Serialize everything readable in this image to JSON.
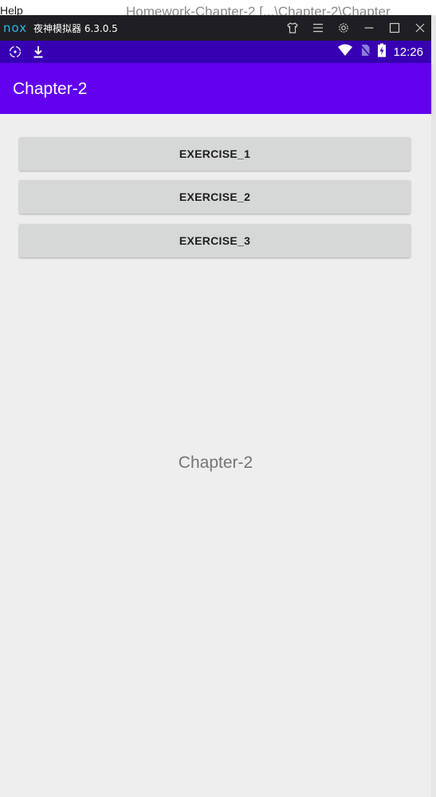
{
  "host": {
    "menu_text": "Help",
    "title_text": "Homework-Chapter-2 [...\\Chapter-2\\Chapter"
  },
  "emulator": {
    "logo_text": "nox",
    "title": "夜神模拟器 6.3.0.5",
    "controls": [
      "tshirt-icon",
      "menu-icon",
      "gear-icon",
      "minimize-icon",
      "maximize-icon",
      "close-icon"
    ]
  },
  "status_bar": {
    "time": "12:26",
    "color": "#3700b3"
  },
  "app_bar": {
    "title": "Chapter-2",
    "color": "#6200ee"
  },
  "buttons": [
    {
      "label": "EXERCISE_1"
    },
    {
      "label": "EXERCISE_2"
    },
    {
      "label": "EXERCISE_3"
    }
  ],
  "center_text": "Chapter-2"
}
